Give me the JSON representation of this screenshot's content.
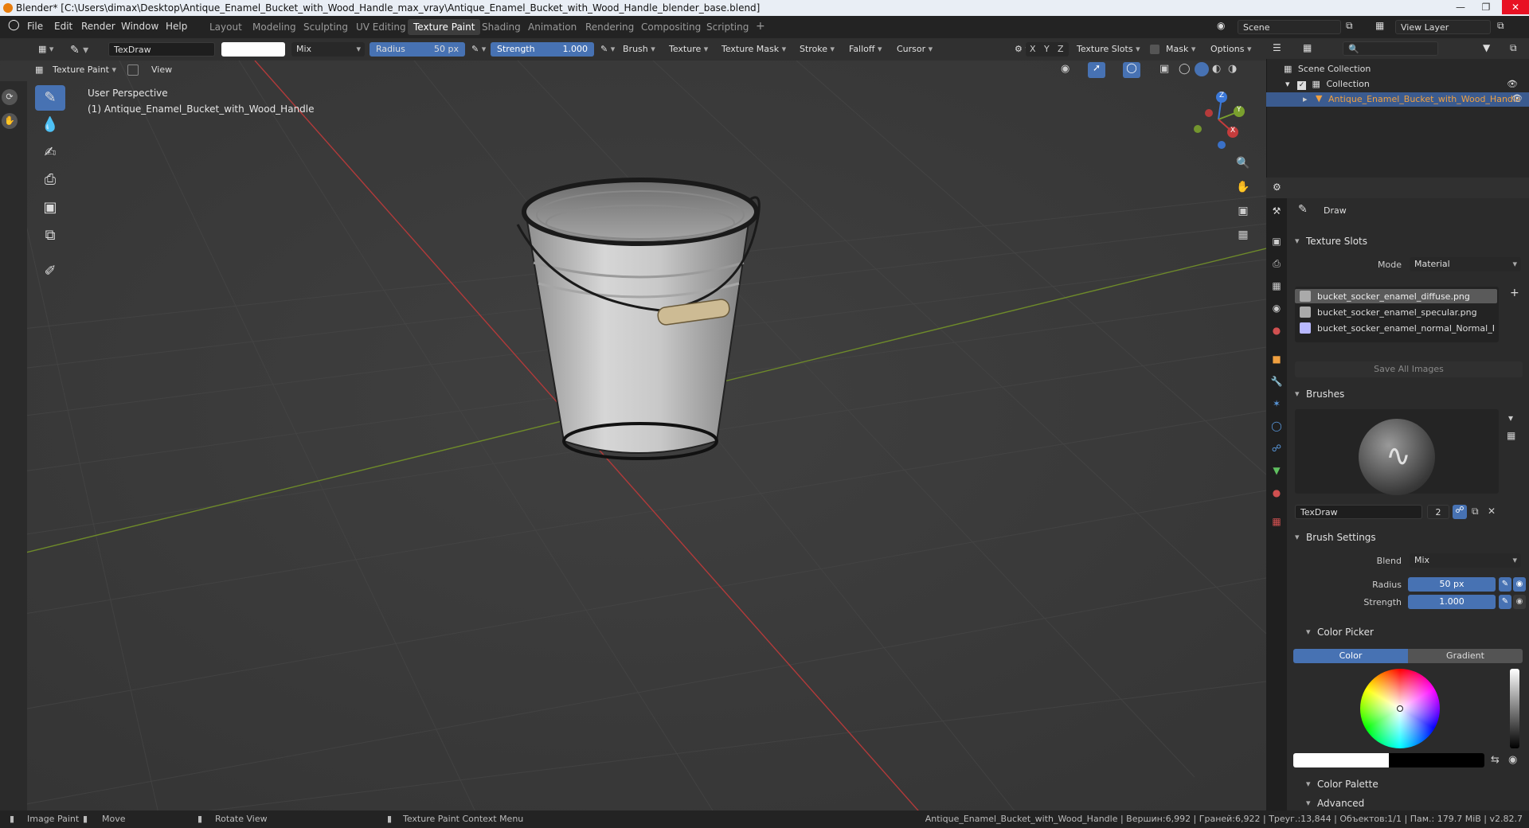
{
  "title_bar": {
    "title": "Blender* [C:\\Users\\dimax\\Desktop\\Antique_Enamel_Bucket_with_Wood_Handle_max_vray\\Antique_Enamel_Bucket_with_Wood_Handle_blender_base.blend]"
  },
  "menu": {
    "items": [
      "File",
      "Edit",
      "Render",
      "Window",
      "Help"
    ]
  },
  "workspaces": {
    "tabs": [
      "Layout",
      "Modeling",
      "Sculpting",
      "UV Editing",
      "Texture Paint",
      "Shading",
      "Animation",
      "Rendering",
      "Compositing",
      "Scripting"
    ],
    "active": "Texture Paint",
    "add": "+"
  },
  "scene": {
    "label": "Scene",
    "view_layer": "View Layer"
  },
  "tool_header": {
    "brush_name": "TexDraw",
    "blend": "Mix",
    "radius_label": "Radius",
    "radius_value": "50 px",
    "strength_label": "Strength",
    "strength_value": "1.000",
    "dropdowns": [
      "Brush",
      "Texture",
      "Texture Mask",
      "Stroke",
      "Falloff",
      "Cursor"
    ],
    "axes": [
      "X",
      "Y",
      "Z"
    ],
    "texture_slots": "Texture Slots",
    "mask": "Mask",
    "options": "Options"
  },
  "viewport_header": {
    "mode": "Texture Paint",
    "view": "View"
  },
  "viewport": {
    "perspective": "User Perspective",
    "object": "(1) Antique_Enamel_Bucket_with_Wood_Handle",
    "gizmo": {
      "x": "X",
      "y": "Y",
      "z": "Z"
    }
  },
  "outliner": {
    "scene_collection": "Scene Collection",
    "collection": "Collection",
    "object": "Antique_Enamel_Bucket_with_Wood_Handle"
  },
  "properties": {
    "tool_name": "Draw",
    "texture_slots": {
      "header": "Texture Slots",
      "mode_label": "Mode",
      "mode_value": "Material",
      "slots": [
        "bucket_socker_enamel_diffuse.png",
        "bucket_socker_enamel_specular.png",
        "bucket_socker_enamel_normal_Normal_B..."
      ],
      "save_all": "Save All Images"
    },
    "brushes": {
      "header": "Brushes",
      "brush_name": "TexDraw",
      "users": "2"
    },
    "brush_settings": {
      "header": "Brush Settings",
      "blend_label": "Blend",
      "blend_value": "Mix",
      "radius_label": "Radius",
      "radius_value": "50 px",
      "strength_label": "Strength",
      "strength_value": "1.000"
    },
    "color_picker": {
      "header": "Color Picker",
      "tab_color": "Color",
      "tab_gradient": "Gradient"
    },
    "color_palette": "Color Palette",
    "advanced": "Advanced"
  },
  "status_bar": {
    "items": [
      "Image Paint",
      "Move",
      "Rotate View",
      "Texture Paint Context Menu"
    ],
    "stats": "Antique_Enamel_Bucket_with_Wood_Handle | Вершин:6,992 | Граней:6,922 | Треуг.:13,844 | Объектов:1/1 | Пам.: 179.7 MiB | v2.82.7"
  },
  "colors": {
    "accent": "#4772b3",
    "viewport_bg": "#3d3d3d",
    "x_axis": "#c04040",
    "y_axis": "#7a9a30"
  }
}
